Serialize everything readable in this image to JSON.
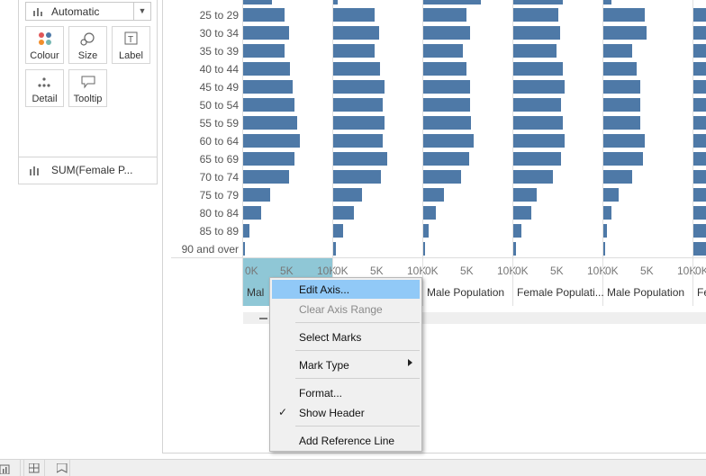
{
  "marks": {
    "type_value": "Automatic",
    "buttons": [
      {
        "label": "Colour",
        "icon": "colour-dots-icon"
      },
      {
        "label": "Size",
        "icon": "size-icon"
      },
      {
        "label": "Label",
        "icon": "label-T-icon"
      },
      {
        "label": "Detail",
        "icon": "detail-dots-icon"
      },
      {
        "label": "Tooltip",
        "icon": "tooltip-bubble-icon"
      }
    ],
    "pill_label": "SUM(Female P..."
  },
  "rows": [
    "25 to 29",
    "30 to 34",
    "35 to 39",
    "40 to 44",
    "45 to 49",
    "50 to 54",
    "55 to 59",
    "60 to 64",
    "65 to 69",
    "70 to 74",
    "75 to 79",
    "80 to 84",
    "85 to 89",
    "90 and over"
  ],
  "axis_ticks": [
    "0K",
    "5K",
    "10K"
  ],
  "column_titles": [
    "Male Population",
    "Male Population",
    "Female Populati...",
    "Male Population",
    "Fe"
  ],
  "partial_first_title": "Mal",
  "bar_color": "#4e79a7",
  "panels": [
    {
      "values": [
        0.5,
        0.55,
        0.5,
        0.57,
        0.6,
        0.62,
        0.65,
        0.68,
        0.62,
        0.55,
        0.33,
        0.22,
        0.08,
        0.02
      ]
    },
    {
      "values": [
        0.5,
        0.55,
        0.5,
        0.57,
        0.62,
        0.6,
        0.62,
        0.6,
        0.65,
        0.58,
        0.35,
        0.25,
        0.12,
        0.03
      ]
    },
    {
      "values": [
        0.52,
        0.56,
        0.48,
        0.52,
        0.57,
        0.57,
        0.58,
        0.61,
        0.55,
        0.46,
        0.25,
        0.15,
        0.06,
        0.01
      ]
    },
    {
      "values": [
        0.54,
        0.57,
        0.52,
        0.6,
        0.62,
        0.58,
        0.6,
        0.62,
        0.58,
        0.48,
        0.28,
        0.22,
        0.1,
        0.03
      ]
    },
    {
      "values": [
        0.5,
        0.52,
        0.35,
        0.4,
        0.45,
        0.45,
        0.45,
        0.5,
        0.48,
        0.35,
        0.18,
        0.1,
        0.04,
        0.02
      ]
    },
    {
      "values": [
        0.9,
        0.95,
        0.85,
        0.95,
        1.0,
        0.95,
        1.0,
        1.0,
        0.95,
        0.9,
        0.7,
        0.6,
        0.35,
        0.2
      ]
    }
  ],
  "context_menu": {
    "items": [
      {
        "label": "Edit Axis...",
        "state": "highlighted"
      },
      {
        "label": "Clear Axis Range",
        "state": "disabled"
      },
      {
        "label": "Select Marks",
        "state": "normal"
      },
      {
        "label": "Mark Type",
        "state": "normal",
        "submenu": true
      },
      {
        "label": "Format...",
        "state": "normal"
      },
      {
        "label": "Show Header",
        "state": "checked"
      },
      {
        "label": "Add Reference Line",
        "state": "normal"
      }
    ]
  }
}
